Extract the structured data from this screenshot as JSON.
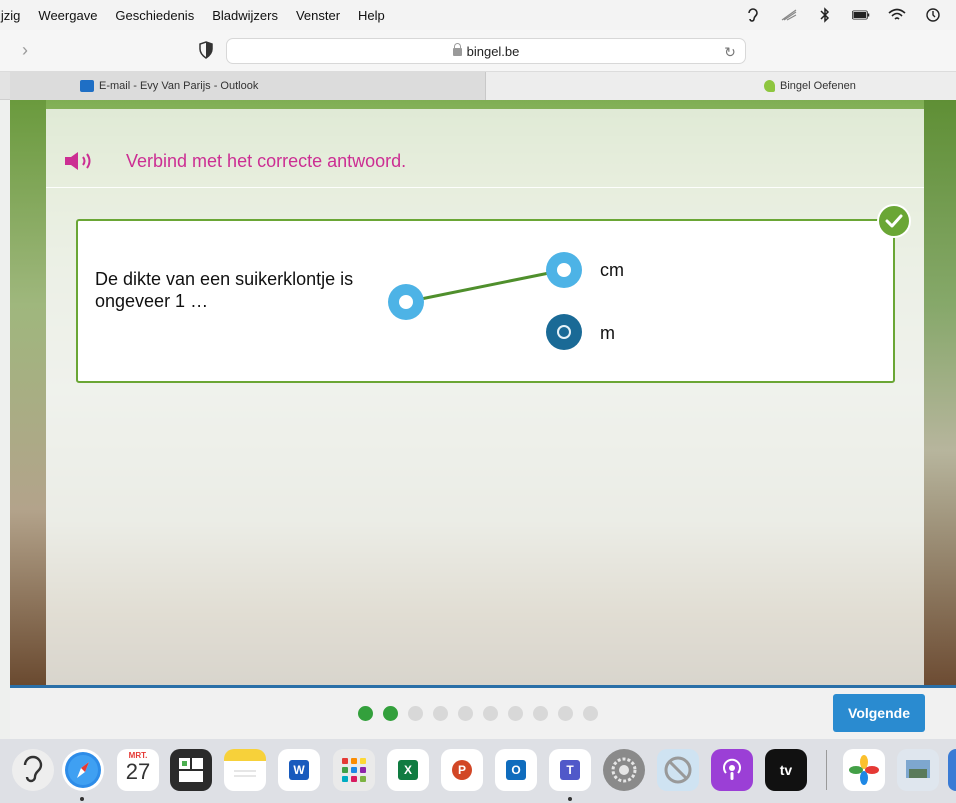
{
  "menubar": {
    "items": [
      "ijzig",
      "Weergave",
      "Geschiedenis",
      "Bladwijzers",
      "Venster",
      "Help"
    ]
  },
  "toolbar": {
    "url": "bingel.be"
  },
  "tabs": [
    {
      "label": "E-mail - Evy Van Parijs - Outlook",
      "icon": "outlook-icon"
    },
    {
      "label": "Bingel Oefenen",
      "icon": "bingel-icon"
    }
  ],
  "exercise": {
    "instruction": "Verbind met het correcte antwoord.",
    "question": "De dikte van een suikerklontje is ongeveer 1 …",
    "answers": [
      "cm",
      "m"
    ],
    "connected_answer": "cm",
    "status": "correct"
  },
  "navigation": {
    "total_steps": 10,
    "completed_steps": 2,
    "next_label": "Volgende"
  },
  "dock": {
    "calendar_month": "MRT.",
    "calendar_day": "27",
    "appletv_label": "tv"
  },
  "colors": {
    "instruction": "#cc2e93",
    "correct_green": "#6aa635",
    "node_light": "#4db3e6",
    "node_dark": "#1a6a96",
    "next_button": "#2a8bd0"
  }
}
